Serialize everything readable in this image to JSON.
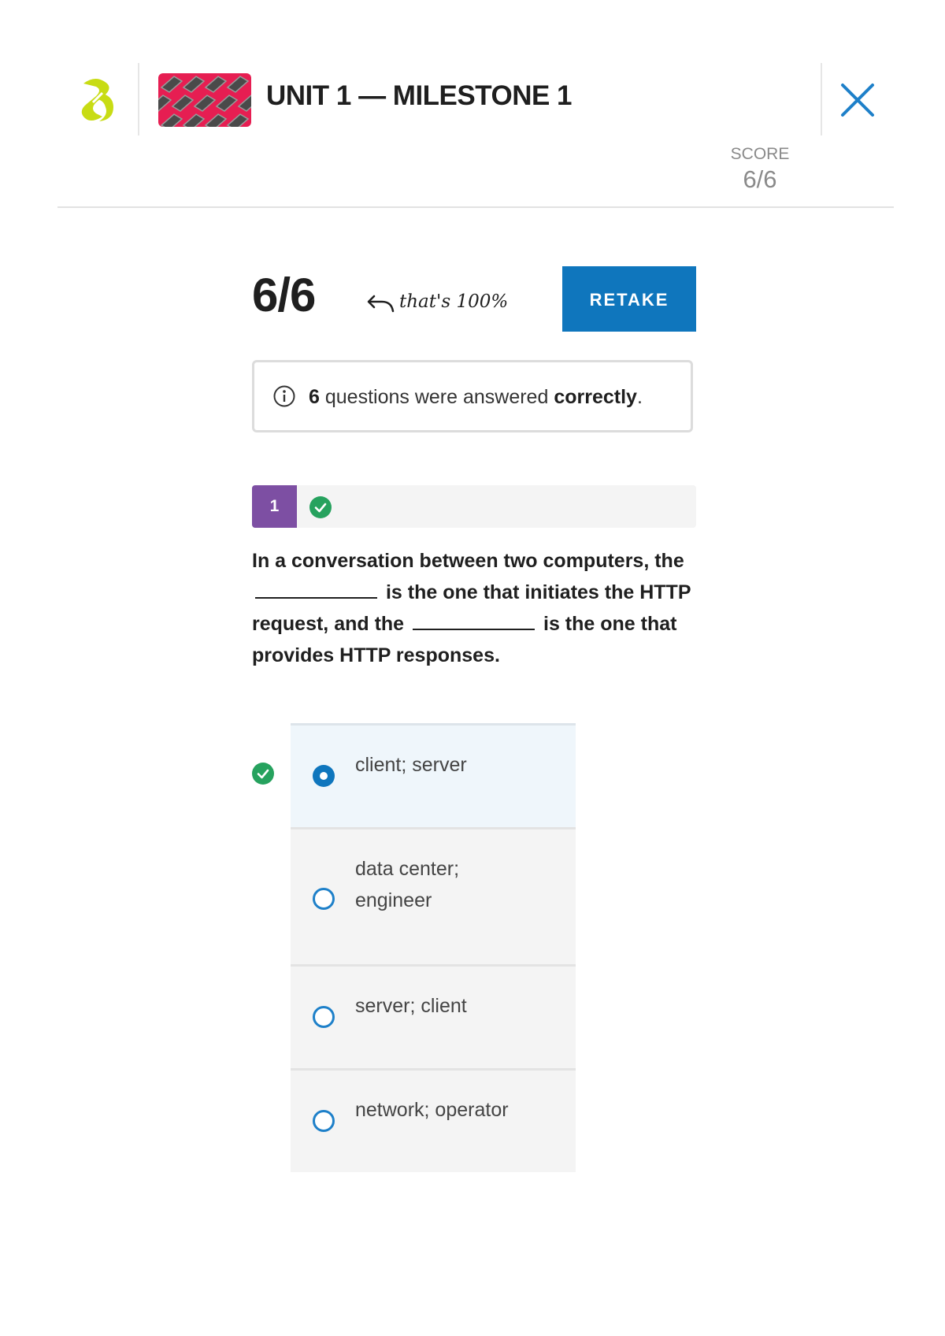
{
  "header": {
    "title": "UNIT 1 — MILESTONE 1",
    "score_label": "SCORE",
    "score_value": "6/6"
  },
  "result": {
    "score": "6/6",
    "note": "that's 100%",
    "retake_label": "RETAKE",
    "summary": {
      "count": "6",
      "text": "questions were answered",
      "emphasis": "correctly",
      "end": "."
    }
  },
  "question": {
    "number": "1",
    "status": "correct",
    "text_parts": [
      "In a conversation between two computers, the",
      "is the one that initiates the HTTP request, and the",
      "is the one that provides HTTP responses."
    ]
  },
  "options": [
    {
      "label": "client; server",
      "selected": true,
      "correct": true
    },
    {
      "label": "data center; engineer",
      "selected": false
    },
    {
      "label": "server; client",
      "selected": false
    },
    {
      "label": "network; operator",
      "selected": false
    }
  ],
  "colors": {
    "brand_accent": "#c8dc14",
    "primary_blue": "#0f76bd",
    "question_badge": "#7d4fa3",
    "success_green": "#26a25e"
  },
  "icons": {
    "logo": "sophia-logo-icon",
    "close": "close-icon",
    "info": "info-icon",
    "check": "check-circle-icon",
    "arrow": "curved-arrow-icon"
  }
}
